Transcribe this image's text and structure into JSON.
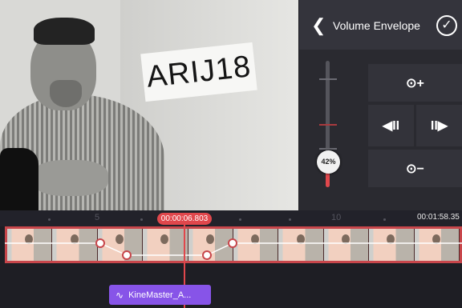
{
  "video": {
    "sign_text": "ARIJ18"
  },
  "panel": {
    "title": "Volume Envelope",
    "back_icon": "chevron-left-icon",
    "confirm_icon": "check-circle-icon",
    "volume_percent": "42%",
    "volume_level": 0.42,
    "buttons": {
      "add_keyframe": "⊙+",
      "prev_keyframe": "◀II",
      "next_keyframe": "II▶",
      "remove_keyframe": "⊙−"
    },
    "accent_color": "#e0474c"
  },
  "timeline": {
    "current_time": "00:00:06.803",
    "end_time": "00:01:58.35",
    "ruler_labels": [
      "5",
      "10"
    ],
    "audio_clip_label": "KineMaster_A...",
    "audio_clip_color": "#8754e8"
  }
}
